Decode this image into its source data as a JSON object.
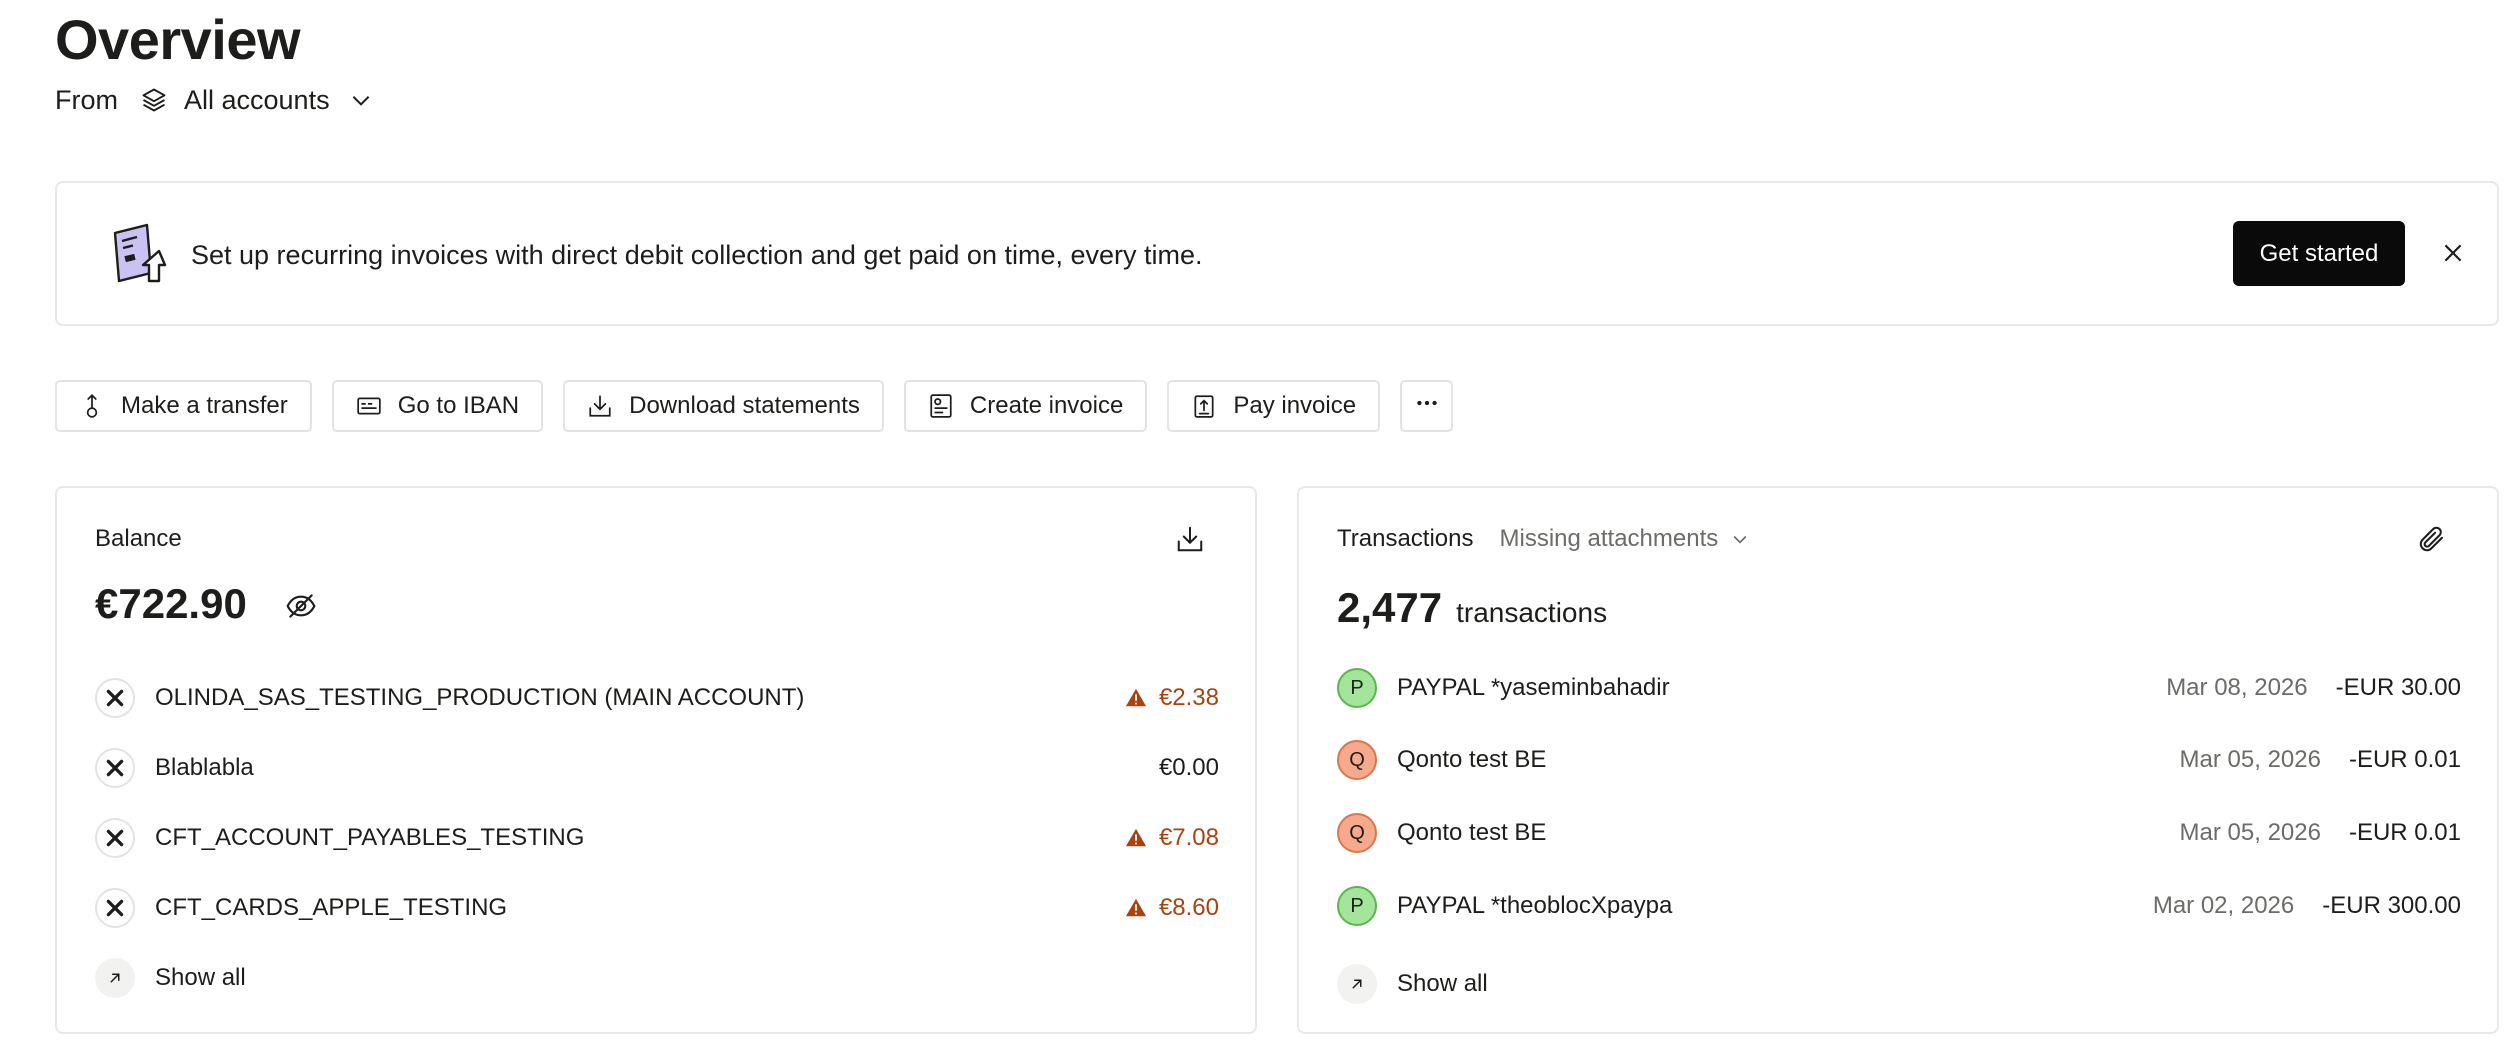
{
  "header": {
    "title": "Overview",
    "from_label": "From",
    "account_selector": "All accounts"
  },
  "banner": {
    "text": "Set up recurring invoices with direct debit collection and get paid on time, every time.",
    "cta_label": "Get started"
  },
  "actions": [
    {
      "label": "Make a transfer",
      "icon": "transfer-icon"
    },
    {
      "label": "Go to IBAN",
      "icon": "iban-card-icon"
    },
    {
      "label": "Download statements",
      "icon": "download-icon"
    },
    {
      "label": "Create invoice",
      "icon": "invoice-icon"
    },
    {
      "label": "Pay invoice",
      "icon": "pay-invoice-icon"
    }
  ],
  "balance": {
    "label": "Balance",
    "amount": "€722.90",
    "accounts": [
      {
        "name": "OLINDA_SAS_TESTING_PRODUCTION (MAIN ACCOUNT)",
        "amount": "€2.38",
        "warning": true
      },
      {
        "name": "Blablabla",
        "amount": "€0.00",
        "warning": false
      },
      {
        "name": "CFT_ACCOUNT_PAYABLES_TESTING",
        "amount": "€7.08",
        "warning": true
      },
      {
        "name": "CFT_CARDS_APPLE_TESTING",
        "amount": "€8.60",
        "warning": true
      }
    ],
    "show_all": "Show all"
  },
  "transactions": {
    "label": "Transactions",
    "filter": "Missing attachments",
    "count": "2,477",
    "count_unit": "transactions",
    "rows": [
      {
        "initial": "P",
        "merchant": "PAYPAL *yaseminbahadir",
        "date": "Mar 08, 2026",
        "amount": "-EUR 30.00"
      },
      {
        "initial": "Q",
        "merchant": "Qonto test BE",
        "date": "Mar 05, 2026",
        "amount": "-EUR 0.01"
      },
      {
        "initial": "Q",
        "merchant": "Qonto test BE",
        "date": "Mar 05, 2026",
        "amount": "-EUR 0.01"
      },
      {
        "initial": "P",
        "merchant": "PAYPAL *theoblocXpaypa",
        "date": "Mar 02, 2026",
        "amount": "-EUR 300.00"
      }
    ],
    "show_all": "Show all"
  },
  "colors": {
    "warning": "#a8420f",
    "primary_button": "#0a0a0a",
    "avatar_paypal": "#a3e59a",
    "avatar_qonto": "#f6a98c"
  }
}
